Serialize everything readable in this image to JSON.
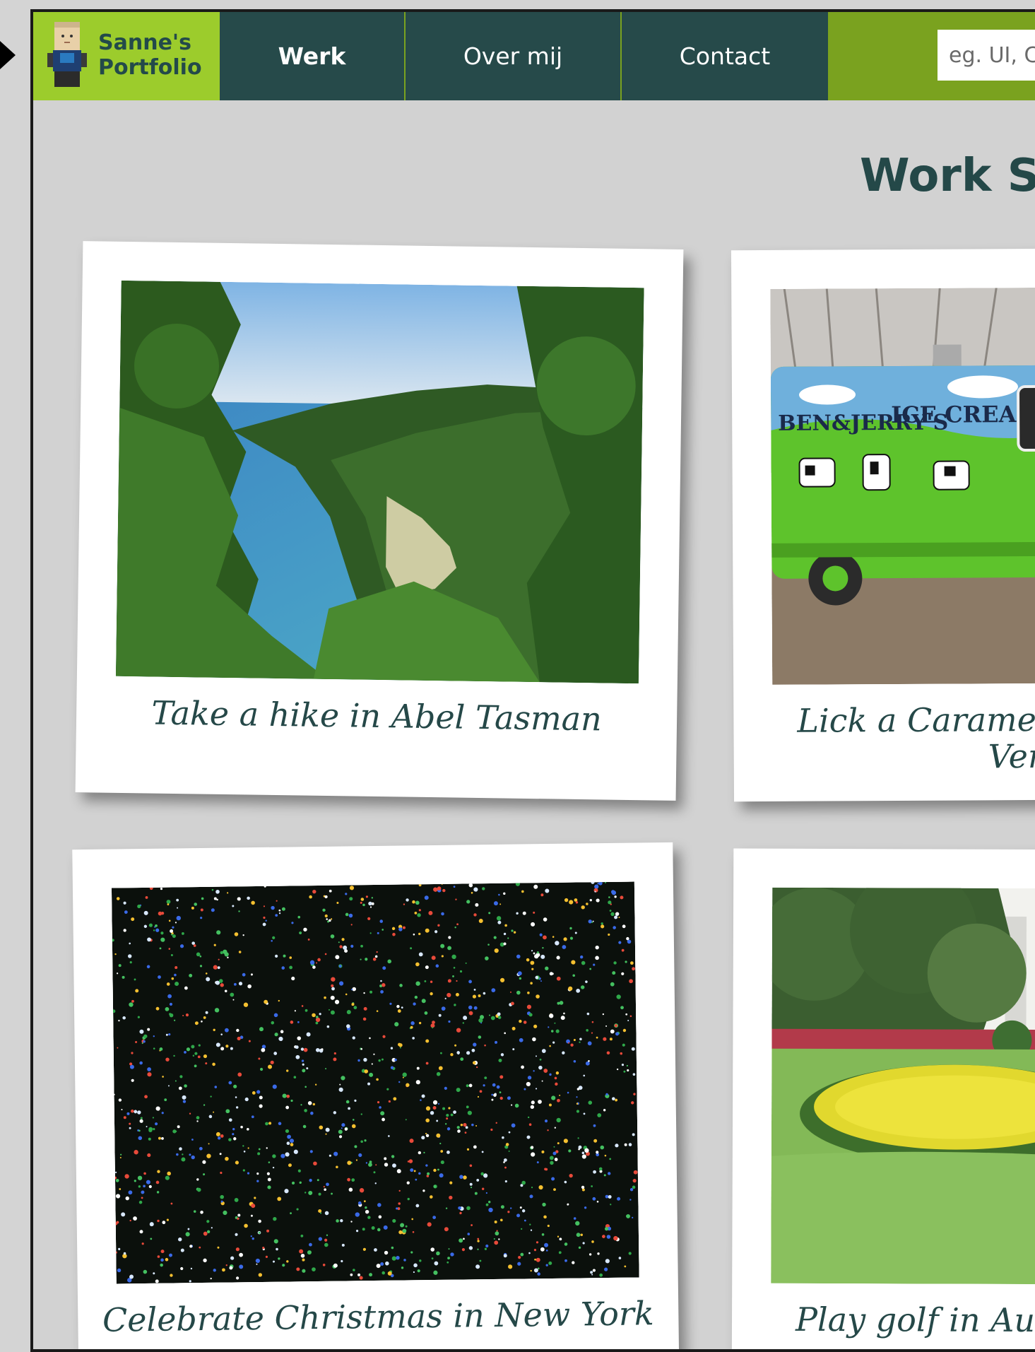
{
  "nav": {
    "logo_line1": "Sanne's",
    "logo_line2": "Portfolio",
    "items": [
      {
        "label": "Werk"
      },
      {
        "label": "Over mij"
      },
      {
        "label": "Contact"
      }
    ],
    "search_placeholder": "eg. UI, C"
  },
  "main": {
    "heading": "Work Sa"
  },
  "cards": [
    {
      "caption": "Take a hike in Abel Tasman"
    },
    {
      "caption_line1": "Lick a Caramel Ch",
      "caption_line2": "Verr"
    },
    {
      "caption": "Celebrate Christmas in New York"
    },
    {
      "caption": "Play golf in Au"
    }
  ],
  "truck_text": {
    "brand": "BEN&JERRY'S",
    "product": "ICE CREAM"
  },
  "colors": {
    "nav_dark": "#264a4a",
    "nav_green": "#7aa21f",
    "logo_green": "#9ccc2c",
    "heading": "#244848",
    "background": "#d2d2d2"
  }
}
